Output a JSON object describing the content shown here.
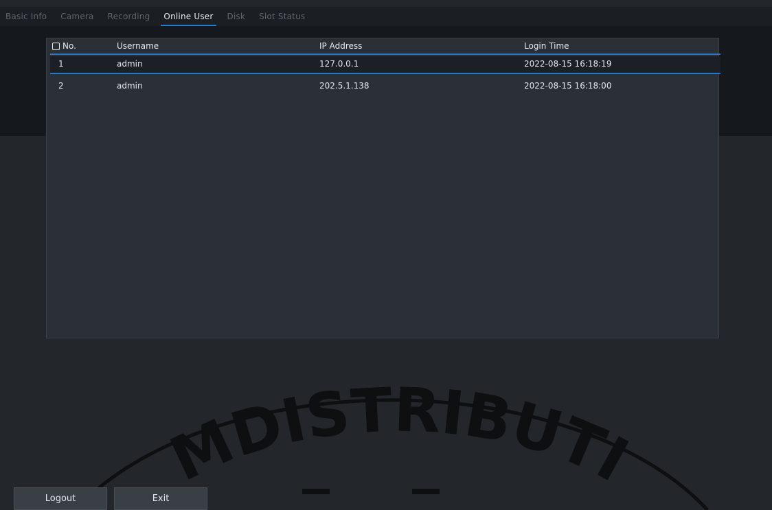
{
  "tabs": [
    {
      "label": "Basic Info"
    },
    {
      "label": "Camera"
    },
    {
      "label": "Recording"
    },
    {
      "label": "Online User"
    },
    {
      "label": "Disk"
    },
    {
      "label": "Slot Status"
    }
  ],
  "active_tab": "Online User",
  "table": {
    "headers": [
      "No.",
      "Username",
      "IP Address",
      "Login Time"
    ],
    "rows": [
      [
        "1",
        "admin",
        "127.0.0.1",
        "2022-08-15 16:18:19"
      ],
      [
        "2",
        "admin",
        "202.5.1.138",
        "2022-08-15 16:18:00"
      ]
    ]
  },
  "watermark": {
    "text": "MDISTRIBUTI"
  },
  "footer": {
    "logout_label": "Logout",
    "exit_label": "Exit"
  },
  "colors": {
    "accent": "#2a78c4",
    "background": "#23272c"
  }
}
